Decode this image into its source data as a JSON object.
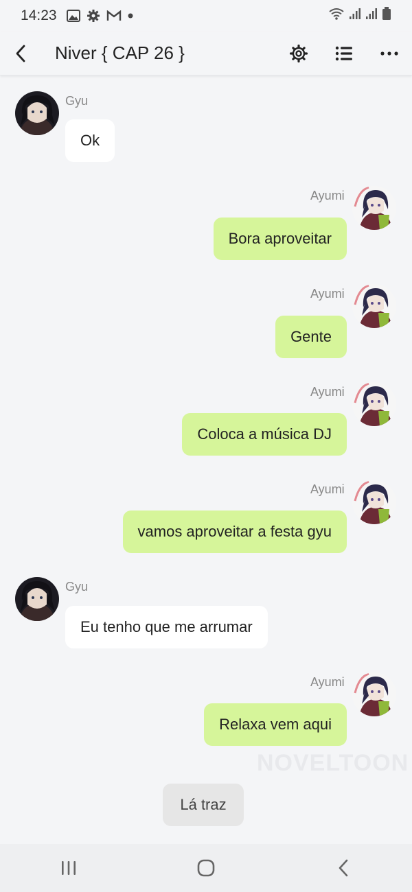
{
  "status_bar": {
    "time": "14:23",
    "icons_left": [
      "image-icon",
      "gear-icon",
      "gmail-icon",
      "dot-icon"
    ],
    "icons_right": [
      "wifi-icon",
      "signal-icon",
      "signal-icon",
      "battery-icon"
    ]
  },
  "header": {
    "title": "Niver { CAP 26 }",
    "icons": [
      "back-icon",
      "settings-icon",
      "list-icon",
      "more-icon"
    ]
  },
  "messages": [
    {
      "side": "left",
      "name": "Gyu",
      "text": "Ok"
    },
    {
      "side": "right",
      "name": "Ayumi",
      "text": "Bora aproveitar"
    },
    {
      "side": "right",
      "name": "Ayumi",
      "text": "Gente"
    },
    {
      "side": "right",
      "name": "Ayumi",
      "text": "Coloca a música DJ"
    },
    {
      "side": "right",
      "name": "Ayumi",
      "text": "vamos aproveitar a festa gyu"
    },
    {
      "side": "left",
      "name": "Gyu",
      "text": "Eu tenho que me arrumar"
    },
    {
      "side": "right",
      "name": "Ayumi",
      "text": "Relaxa vem aqui"
    }
  ],
  "watermark": "NOVELTOON",
  "choice_button": "Lá traz",
  "colors": {
    "background": "#f4f5f7",
    "right_bubble": "#d6f59a",
    "left_bubble": "#ffffff"
  },
  "nav_bar": {
    "icons": [
      "recent-apps-icon",
      "home-icon",
      "back-icon"
    ]
  }
}
